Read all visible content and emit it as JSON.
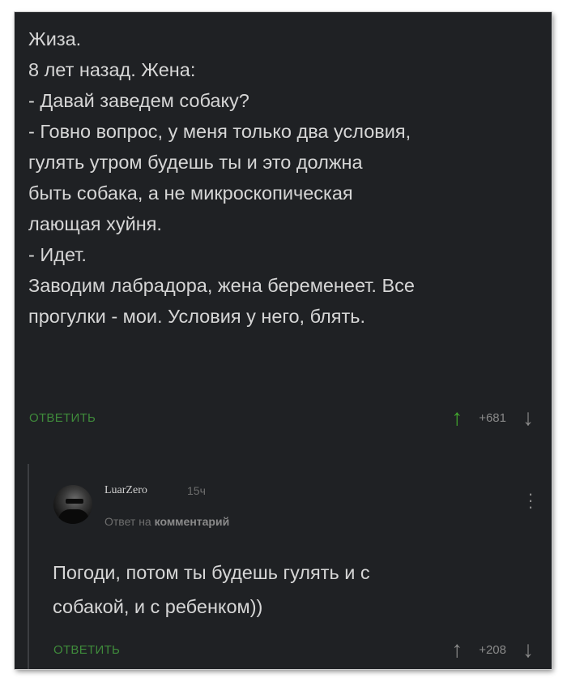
{
  "post": {
    "lines": [
      "Жиза.",
      "8 лет назад. Жена:",
      "- Давай заведем собаку?",
      "- Говно вопрос, у меня только два условия,",
      "гулять утром будешь ты и это должна",
      "быть собака, а не микроскопическая",
      "лающая хуйня.",
      "- Идет.",
      "Заводим лабрадора, жена беременеет. Все",
      "прогулки - мои. Условия у него, блять."
    ],
    "reply_label": "ОТВЕТИТЬ",
    "score": "+681"
  },
  "comment": {
    "username": "LuarZero",
    "time": "15ч",
    "reply_to_prefix": "Ответ на",
    "reply_to_target": "комментарий",
    "lines": [
      "Погоди, потом ты будешь гулять и с",
      "собакой, и с ребенком))"
    ],
    "reply_label": "ОТВЕТИТЬ",
    "score": "+208"
  },
  "icons": {
    "upvote": "arrow-up-icon",
    "downvote": "arrow-down-icon",
    "more": "kebab-menu-icon",
    "accent_color": "#43a82f"
  }
}
